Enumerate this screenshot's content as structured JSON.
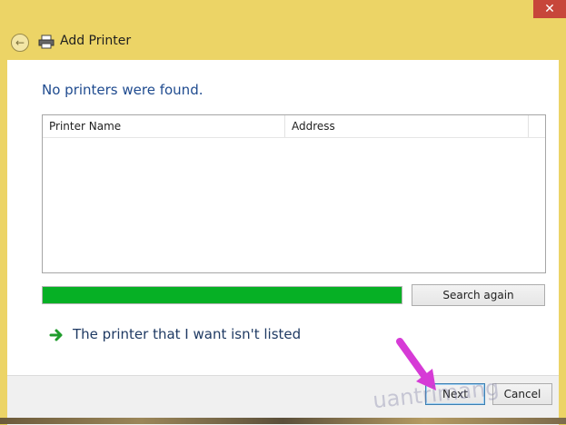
{
  "window": {
    "title": "Add Printer",
    "close_glyph": "✕",
    "back_glyph": "←"
  },
  "content": {
    "heading": "No printers were found.",
    "table": {
      "headers": [
        "Printer Name",
        "Address"
      ],
      "rows": []
    },
    "progress_percent": 100,
    "search_again_label": "Search again",
    "link_label": "The printer that I want isn't listed"
  },
  "footer": {
    "next_label": "Next",
    "cancel_label": "Cancel"
  },
  "watermark": {
    "text": "uantrimang"
  },
  "colors": {
    "frame": "#ecd466",
    "progress": "#06b025",
    "heading": "#1f4b8f",
    "pointer": "#d63bd6"
  },
  "icons": [
    "back-arrow-icon",
    "printer-icon",
    "green-arrow-icon",
    "pointer-arrow-icon"
  ]
}
